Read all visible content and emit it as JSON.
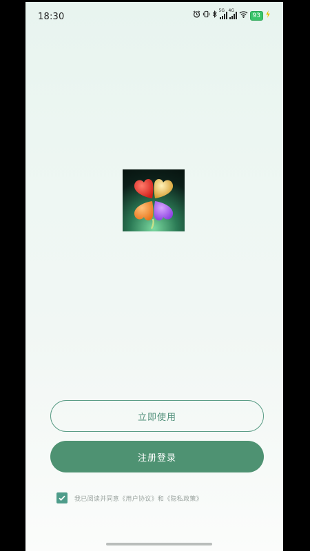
{
  "status_bar": {
    "time": "18:30",
    "network_labels": [
      "5G",
      "4G"
    ],
    "battery": "93",
    "icons": [
      "alarm-icon",
      "vibrate-icon",
      "bluetooth-icon",
      "signal-icon",
      "wifi-icon",
      "battery-icon",
      "charging-icon"
    ]
  },
  "logo": {
    "icon": "four-leaf-clover-icon",
    "colors": {
      "leaf_top_left": "#e33a2c",
      "leaf_top_right": "#e7b04a",
      "leaf_bottom_left": "#f08a2e",
      "leaf_bottom_right": "#9a4ee0",
      "background": "#0c1f19"
    }
  },
  "actions": {
    "use_now_label": "立即使用",
    "register_login_label": "注册登录"
  },
  "agreement": {
    "checked": true,
    "text": "我已阅读并同意《用户协议》和《隐私政策》"
  },
  "theme": {
    "accent": "#4e9272",
    "outline": "#5b9d86"
  }
}
